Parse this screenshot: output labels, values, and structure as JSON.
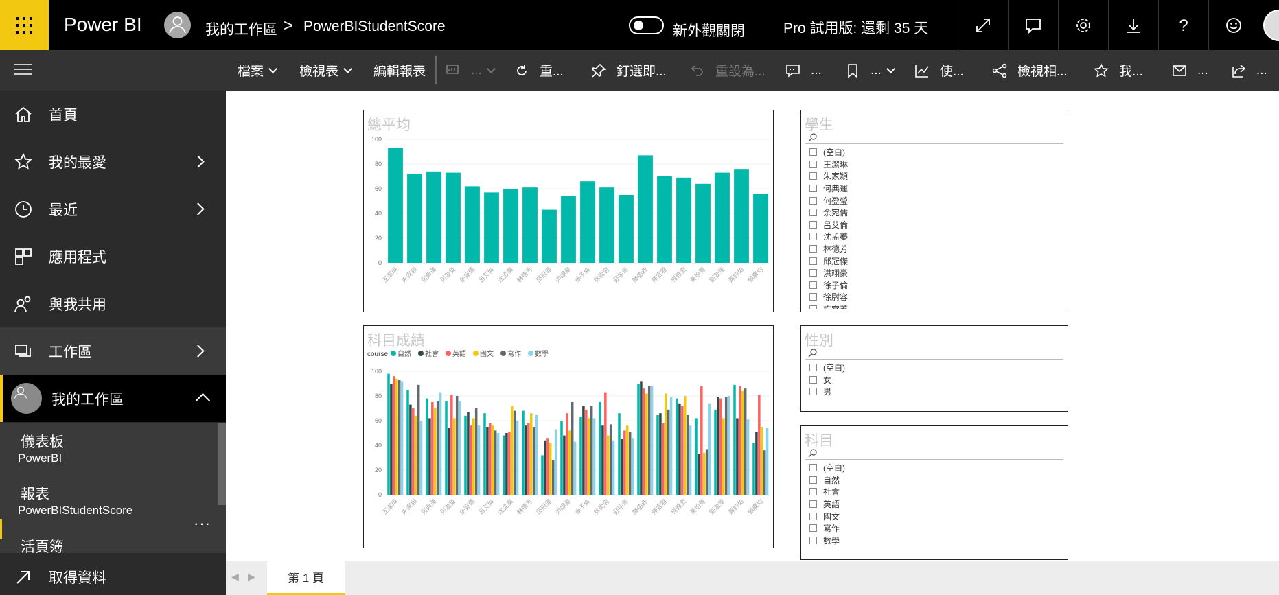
{
  "topbar": {
    "brand": "Power BI",
    "breadcrumb_workspace": "我的工作區",
    "breadcrumb_separator": ">",
    "breadcrumb_report": "PowerBIStudentScore",
    "new_look_label": "新外觀關閉",
    "trial_label": "Pro 試用版: 還剩 35 天",
    "buttons": [
      "expand-icon",
      "comment-icon",
      "settings-icon",
      "download-icon",
      "help-icon",
      "feedback-icon"
    ]
  },
  "commandbar": {
    "file": "檔案",
    "view": "檢視表",
    "edit_report": "編輯報表",
    "disabled_more": "...",
    "refresh": "重...",
    "pin": "釘選即...",
    "reset": "重設為...",
    "comment": "...",
    "bookmark": "...",
    "usage": "使...",
    "lineage": "檢視相...",
    "favorite": "我...",
    "subscribe": "...",
    "share": "..."
  },
  "sidebar": {
    "home": "首頁",
    "favorites": "我的最愛",
    "recent": "最近",
    "apps": "應用程式",
    "shared": "與我共用",
    "workspaces": "工作區",
    "my_workspace": "我的工作區",
    "dashboards_header": "儀表板",
    "dashboard_item": "PowerBI",
    "reports_header": "報表",
    "report_item": "PowerBIStudentScore",
    "more": "···",
    "workbooks_header": "活頁簿",
    "get_data": "取得資料"
  },
  "visuals": {
    "avg_title": "總平均",
    "subject_title": "科目成績",
    "legend_title": "course",
    "student_slicer_title": "學生",
    "gender_slicer_title": "性別",
    "subject_slicer_title": "科目"
  },
  "slicers": {
    "students": [
      "(空白)",
      "王潔琳",
      "朱家穎",
      "何典運",
      "何盈瑩",
      "余宛儒",
      "呂艾倫",
      "沈孟蓁",
      "林德芳",
      "邱冠傑",
      "洪翊豪",
      "徐子倫",
      "徐尉容",
      "許宜蓁"
    ],
    "genders": [
      "(空白)",
      "女",
      "男"
    ],
    "subjects": [
      "(空白)",
      "自然",
      "社會",
      "英語",
      "國文",
      "寫作",
      "數學"
    ]
  },
  "tabs": {
    "page1": "第 1 頁"
  },
  "chart_data": [
    {
      "type": "bar",
      "title": "總平均",
      "categories": [
        "王潔琳",
        "朱家穎",
        "何典運",
        "何盈瑩",
        "余宛儒",
        "呂艾倫",
        "沈孟蓁",
        "林德芳",
        "邱冠傑",
        "洪翊豪",
        "徐子倫",
        "徐尉容",
        "莊宇彤",
        "陳佑政",
        "陳宜君",
        "程雅雯",
        "黃怡菁",
        "劉盈瑩",
        "蕭鈞佑",
        "賴廣均"
      ],
      "values": [
        93,
        72,
        74,
        73,
        62,
        57,
        60,
        61,
        43,
        54,
        66,
        61,
        55,
        87,
        70,
        69,
        64,
        73,
        76,
        56
      ],
      "ylim": [
        0,
        100
      ],
      "yticks": [
        0,
        20,
        40,
        60,
        80,
        100
      ],
      "color": "#01b8aa"
    },
    {
      "type": "bar",
      "title": "科目成績",
      "legend_title": "course",
      "categories": [
        "王潔琳",
        "朱家穎",
        "何典運",
        "何盈瑩",
        "余宛儒",
        "呂艾倫",
        "沈孟蓁",
        "林德芳",
        "邱冠傑",
        "洪翊豪",
        "徐子倫",
        "徐尉容",
        "莊宇彤",
        "陳佑政",
        "陳宜君",
        "程雅雯",
        "黃怡菁",
        "劉盈瑩",
        "蕭鈞佑",
        "賴廣均"
      ],
      "ylim": [
        0,
        100
      ],
      "yticks": [
        0,
        20,
        40,
        60,
        80,
        100
      ],
      "series": [
        {
          "name": "自然",
          "color": "#01b8aa",
          "values": [
            98,
            85,
            78,
            76,
            64,
            66,
            48,
            68,
            32,
            60,
            63,
            75,
            66,
            90,
            65,
            78,
            62,
            69,
            89,
            42
          ]
        },
        {
          "name": "社會",
          "color": "#374649",
          "values": [
            90,
            73,
            62,
            54,
            67,
            55,
            50,
            56,
            44,
            48,
            72,
            56,
            45,
            92,
            66,
            74,
            33,
            79,
            62,
            51
          ]
        },
        {
          "name": "英語",
          "color": "#fd625e",
          "values": [
            96,
            70,
            75,
            81,
            56,
            58,
            51,
            58,
            46,
            66,
            69,
            83,
            52,
            86,
            58,
            72,
            88,
            78,
            88,
            81
          ]
        },
        {
          "name": "國文",
          "color": "#f2c80f",
          "values": [
            94,
            64,
            70,
            62,
            62,
            56,
            72,
            66,
            42,
            52,
            62,
            48,
            56,
            82,
            82,
            80,
            34,
            62,
            84,
            55
          ]
        },
        {
          "name": "寫作",
          "color": "#5f6b6d",
          "values": [
            93,
            89,
            76,
            80,
            70,
            52,
            68,
            55,
            28,
            75,
            72,
            57,
            51,
            88,
            69,
            65,
            37,
            79,
            86,
            36
          ]
        },
        {
          "name": "數學",
          "color": "#8ad4eb",
          "values": [
            92,
            60,
            83,
            76,
            56,
            50,
            60,
            65,
            53,
            43,
            62,
            44,
            46,
            88,
            79,
            56,
            74,
            80,
            61,
            54
          ]
        }
      ]
    }
  ]
}
